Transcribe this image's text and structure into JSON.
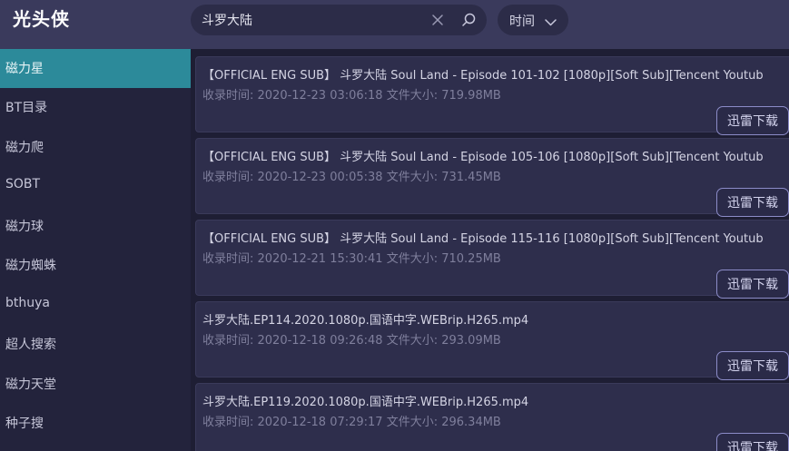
{
  "app": {
    "title": "光头侠"
  },
  "search": {
    "value": "斗罗大陆",
    "placeholder": ""
  },
  "sort": {
    "label": "时间"
  },
  "sidebar": {
    "items": [
      {
        "label": "磁力星"
      },
      {
        "label": "BT目录"
      },
      {
        "label": "磁力爬"
      },
      {
        "label": "SOBT"
      },
      {
        "label": "磁力球"
      },
      {
        "label": "磁力蜘蛛"
      },
      {
        "label": "bthuya"
      },
      {
        "label": "超人搜索"
      },
      {
        "label": "磁力天堂"
      },
      {
        "label": "种子搜"
      }
    ],
    "active_index": 0
  },
  "results": [
    {
      "title": "【OFFICIAL ENG SUB】 斗罗大陆 Soul Land - Episode 101-102 [1080p][Soft Sub][Tencent Youtub",
      "meta": "收录时间: 2020-12-23 03:06:18 文件大小: 719.98MB",
      "button": "迅雷下载"
    },
    {
      "title": "【OFFICIAL ENG SUB】 斗罗大陆 Soul Land - Episode 105-106 [1080p][Soft Sub][Tencent Youtub",
      "meta": "收录时间: 2020-12-23 00:05:38 文件大小: 731.45MB",
      "button": "迅雷下载"
    },
    {
      "title": "【OFFICIAL ENG SUB】 斗罗大陆 Soul Land - Episode 115-116 [1080p][Soft Sub][Tencent Youtub",
      "meta": "收录时间: 2020-12-21 15:30:41 文件大小: 710.25MB",
      "button": "迅雷下载"
    },
    {
      "title": "斗罗大陆.EP114.2020.1080p.国语中字.WEBrip.H265.mp4",
      "meta": "收录时间: 2020-12-18 09:26:48 文件大小: 293.09MB",
      "button": "迅雷下载"
    },
    {
      "title": "斗罗大陆.EP119.2020.1080p.国语中字.WEBrip.H265.mp4",
      "meta": "收录时间: 2020-12-18 07:29:17 文件大小: 296.34MB",
      "button": "迅雷下载"
    }
  ],
  "icons": {
    "clear": "close-icon",
    "search": "search-icon",
    "sort": "chevron-down-icon"
  },
  "colors": {
    "accent": "#2c8a9a",
    "topbar": "#3a3a5c",
    "button_border": "#8c8cc8"
  }
}
